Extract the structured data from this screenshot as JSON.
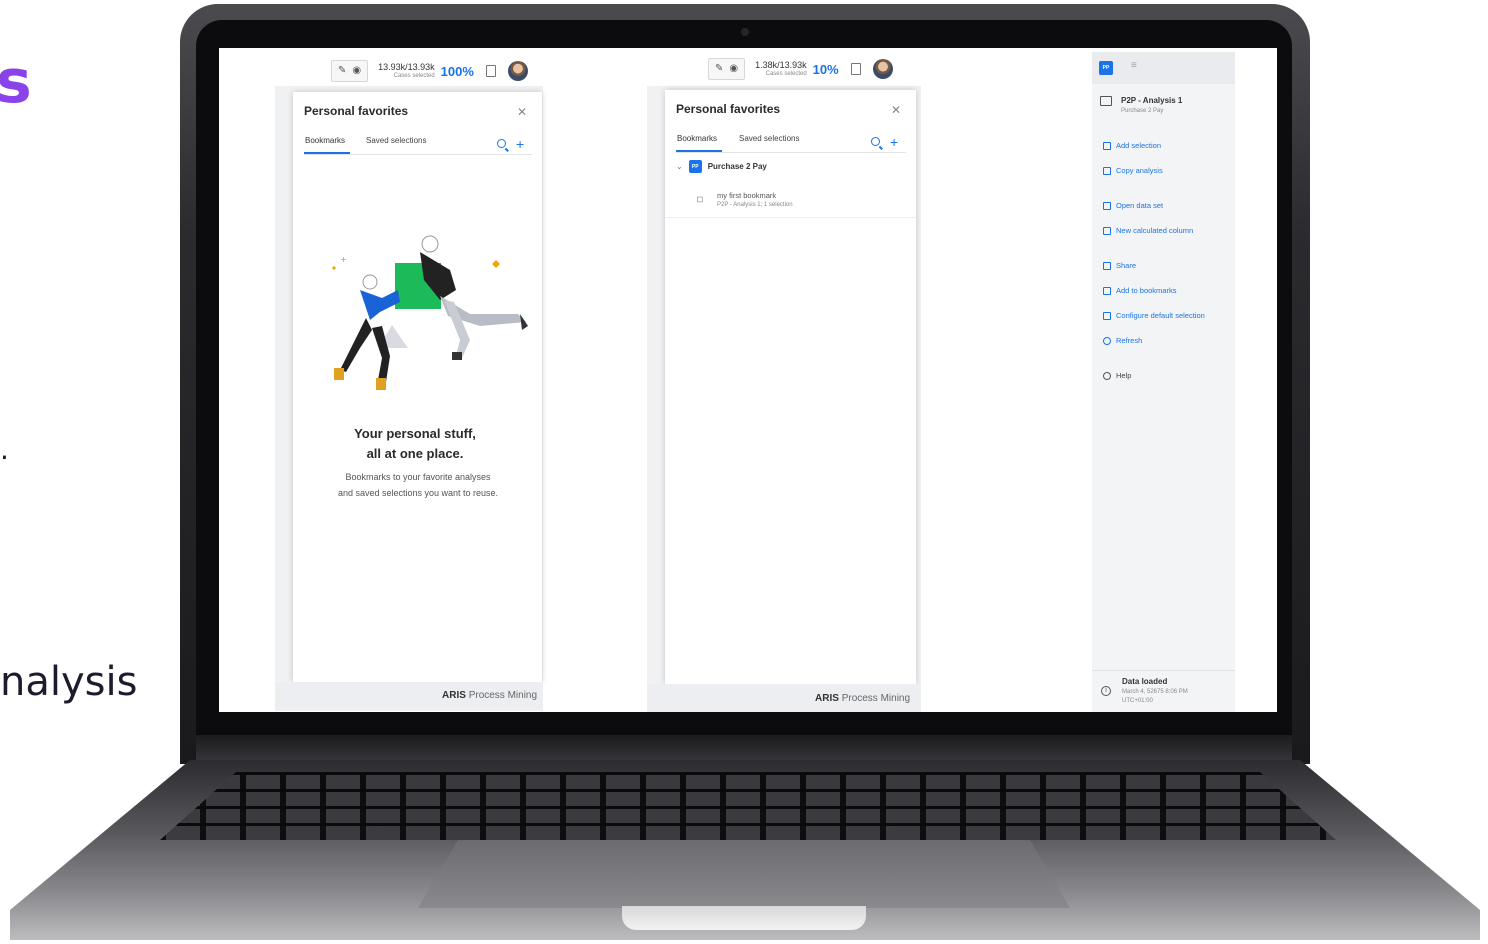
{
  "slide_fragments": {
    "heading_tail": "s",
    "bullet_tail": ".",
    "text_tail": "nalysis"
  },
  "colors": {
    "accent": "#1a73e8",
    "slide_purple": "#8a43e8",
    "pp_badge": "#1a73e8"
  },
  "screen1": {
    "cases_count": "13.93k/13.93k",
    "cases_label": "Cases selected",
    "percent": "100%",
    "panel_title": "Personal favorites",
    "tabs": [
      "Bookmarks",
      "Saved selections"
    ],
    "empty_heading_line1": "Your personal stuff,",
    "empty_heading_line2": "all at one place.",
    "empty_text_line1": "Bookmarks to your favorite analyses",
    "empty_text_line2": "and saved selections you want to reuse.",
    "brand_bold": "ARIS",
    "brand_rest": "Process Mining"
  },
  "screen2": {
    "cases_count": "1.38k/13.93k",
    "cases_label": "Cases selected",
    "percent": "10%",
    "panel_title": "Personal favorites",
    "tabs": [
      "Bookmarks",
      "Saved selections"
    ],
    "group_badge": "PP",
    "group_name": "Purchase 2 Pay",
    "bookmark_name": "my first bookmark",
    "bookmark_detail": "P2P - Analysis 1; 1 selection",
    "brand_bold": "ARIS",
    "brand_rest": "Process Mining"
  },
  "screen3": {
    "badge": "PP",
    "analysis_title": "P2P - Analysis 1",
    "analysis_subtitle": "Purchase 2 Pay",
    "menu": [
      "Add selection",
      "Copy analysis",
      "Open data set",
      "New calculated column",
      "Share",
      "Add to bookmarks",
      "Configure default selection",
      "Refresh",
      "Help"
    ],
    "status_title": "Data loaded",
    "status_line1": "March 4, 52675 8:06 PM",
    "status_line2": "UTC+01:00"
  },
  "icons": [
    "pencil-icon",
    "eye-icon",
    "bookmark-icon",
    "avatar",
    "close-icon",
    "search-icon",
    "plus-icon",
    "chevron-down-icon",
    "tag-icon",
    "info-icon",
    "hamburger-icon"
  ]
}
